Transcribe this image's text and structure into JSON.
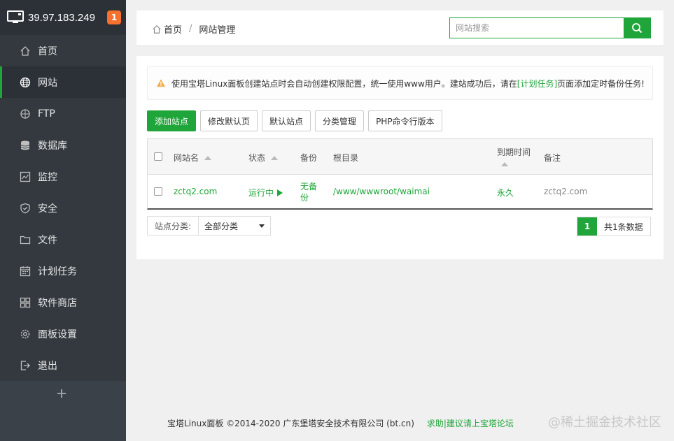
{
  "sidebar": {
    "ip": "39.97.183.249",
    "badge": "1",
    "items": [
      {
        "label": "首页",
        "icon": "home-icon"
      },
      {
        "label": "网站",
        "icon": "globe-icon",
        "active": true
      },
      {
        "label": "FTP",
        "icon": "ftp-icon"
      },
      {
        "label": "数据库",
        "icon": "database-icon"
      },
      {
        "label": "监控",
        "icon": "monitor-chart-icon"
      },
      {
        "label": "安全",
        "icon": "shield-icon"
      },
      {
        "label": "文件",
        "icon": "folder-icon"
      },
      {
        "label": "计划任务",
        "icon": "calendar-icon"
      },
      {
        "label": "软件商店",
        "icon": "grid-icon"
      },
      {
        "label": "面板设置",
        "icon": "gear-icon"
      },
      {
        "label": "退出",
        "icon": "logout-icon"
      }
    ]
  },
  "breadcrumb": {
    "home": "首页",
    "separator": "/",
    "current": "网站管理"
  },
  "search": {
    "placeholder": "网站搜索",
    "value": ""
  },
  "tip": {
    "text_before": "使用宝塔Linux面板创建站点时会自动创建权限配置，统一使用www用户。建站成功后，请在",
    "link": "[计划任务]",
    "text_after": "页面添加定时备份任务!"
  },
  "toolbar": {
    "add_site": "添加站点",
    "edit_default_page": "修改默认页",
    "default_site": "默认站点",
    "category_manage": "分类管理",
    "php_cli_version": "PHP命令行版本"
  },
  "table": {
    "headers": {
      "name": "网站名",
      "status": "状态",
      "backup": "备份",
      "root": "根目录",
      "expire": "到期时间",
      "remark": "备注"
    },
    "rows": [
      {
        "name": "zctq2.com",
        "status": "运行中",
        "backup_line1": "无备",
        "backup_line2": "份",
        "root": "/www/wwwroot/waimai",
        "expire": "永久",
        "remark": "zctq2.com"
      }
    ]
  },
  "filter": {
    "label": "站点分类:",
    "selected": "全部分类"
  },
  "pager": {
    "current": "1",
    "total": "共1条数据"
  },
  "footer": {
    "copyright": "宝塔Linux面板 ©2014-2020 广东堡塔安全技术有限公司 (bt.cn)",
    "help": "求助|建议请上宝塔论坛"
  },
  "watermark": "@稀土掘金技术社区",
  "colors": {
    "accent": "#20a53a",
    "sidebar_bg": "#33393f",
    "badge": "#f7712c"
  }
}
